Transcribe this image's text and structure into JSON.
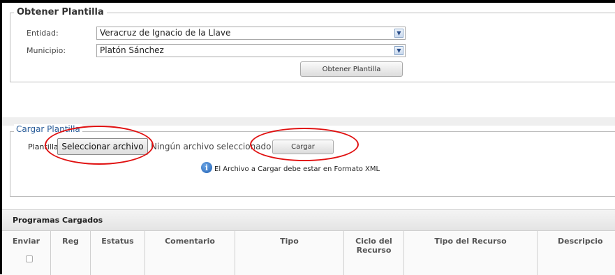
{
  "obtener": {
    "legend": "Obtener Plantilla",
    "entidad_label": "Entidad:",
    "entidad_value": "Veracruz de Ignacio de la Llave",
    "municipio_label": "Municipio:",
    "municipio_value": "Platón Sánchez",
    "button": "Obtener Plantilla"
  },
  "cargar": {
    "legend": "Cargar Plantilla",
    "plantilla_label": "Plantilla:",
    "file_button": "Seleccionar archivo",
    "no_file": "Ningún archivo seleccionado",
    "cargar_button": "Cargar",
    "info": "El Archivo a Cargar debe estar en Formato XML"
  },
  "table": {
    "title": "Programas Cargados",
    "columns": [
      "Enviar",
      "Reg",
      "Estatus",
      "Comentario",
      "Tipo",
      "Ciclo del Recurso",
      "Tipo del Recurso",
      "Descripcio"
    ]
  },
  "colors": {
    "annotation": "#e01010",
    "legend_blue": "#2a5d9a"
  }
}
